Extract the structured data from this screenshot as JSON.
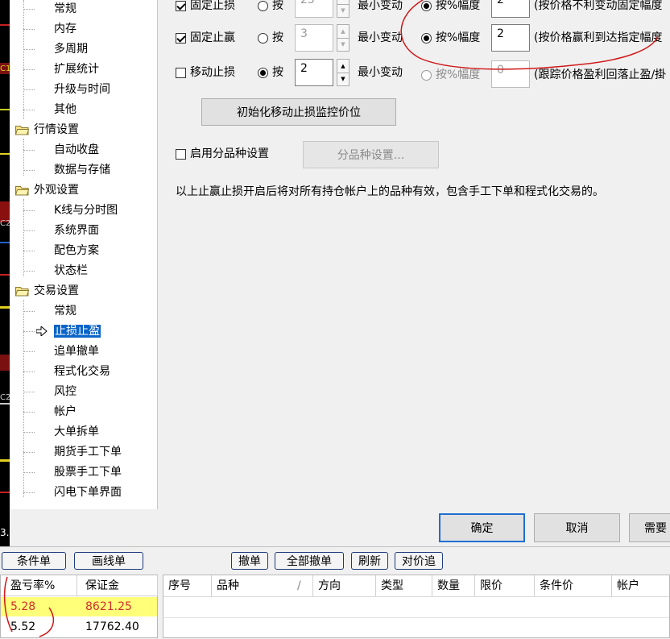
{
  "tree": {
    "items": [
      {
        "id": "general1",
        "label": "常规",
        "type": "child"
      },
      {
        "id": "memory",
        "label": "内存",
        "type": "child"
      },
      {
        "id": "multiperiod",
        "label": "多周期",
        "type": "child"
      },
      {
        "id": "extstats",
        "label": "扩展统计",
        "type": "child"
      },
      {
        "id": "upgrade",
        "label": "升级与时间",
        "type": "child"
      },
      {
        "id": "other",
        "label": "其他",
        "type": "child"
      },
      {
        "id": "quote",
        "label": "行情设置",
        "type": "group"
      },
      {
        "id": "autoclose",
        "label": "自动收盘",
        "type": "child"
      },
      {
        "id": "datastore",
        "label": "数据与存储",
        "type": "child"
      },
      {
        "id": "appearance",
        "label": "外观设置",
        "type": "group"
      },
      {
        "id": "kline",
        "label": "K线与分时图",
        "type": "child"
      },
      {
        "id": "sysui",
        "label": "系统界面",
        "type": "child"
      },
      {
        "id": "colors",
        "label": "配色方案",
        "type": "child"
      },
      {
        "id": "statusbar",
        "label": "状态栏",
        "type": "child"
      },
      {
        "id": "trade",
        "label": "交易设置",
        "type": "group"
      },
      {
        "id": "general2",
        "label": "常规",
        "type": "child"
      },
      {
        "id": "stoploss",
        "label": "止损止盈",
        "type": "child",
        "selected": true
      },
      {
        "id": "chase",
        "label": "追单撤单",
        "type": "child"
      },
      {
        "id": "algo",
        "label": "程式化交易",
        "type": "child"
      },
      {
        "id": "risk",
        "label": "风控",
        "type": "child"
      },
      {
        "id": "account",
        "label": "帐户",
        "type": "child"
      },
      {
        "id": "split",
        "label": "大单拆单",
        "type": "child"
      },
      {
        "id": "futures",
        "label": "期货手工下单",
        "type": "child"
      },
      {
        "id": "stocks",
        "label": "股票手工下单",
        "type": "child"
      },
      {
        "id": "flash",
        "label": "闪电下单界面",
        "type": "child"
      }
    ]
  },
  "stop_settings": {
    "fixed_stop_loss": {
      "label": "固定止损",
      "checked": true,
      "by_label": "按",
      "by_value": "25",
      "min_change": "最小变动",
      "pct_label": "按%幅度",
      "pct_value": "2",
      "desc": "(按价格不利变动固定幅度"
    },
    "fixed_take_profit": {
      "label": "固定止赢",
      "checked": true,
      "by_label": "按",
      "by_value": "3",
      "min_change": "最小变动",
      "pct_label": "按%幅度",
      "pct_value": "2",
      "desc": "(按价格赢利到达指定幅度"
    },
    "trailing_stop": {
      "label": "移动止损",
      "checked": false,
      "by_label": "按",
      "by_value": "2",
      "min_change": "最小变动",
      "pct_label": "按%幅度",
      "pct_value": "0",
      "desc": "(跟踪价格盈利回落止盈/掛"
    }
  },
  "init_trailing_button": "初始化移动止损监控价位",
  "per_product": {
    "checkbox_label": "启用分品种设置",
    "button_label": "分品种设置..."
  },
  "note": "以上止赢止损开启后将对所有持仓帐户上的品种有效，包含手工下单和程式化交易的。",
  "dialog_buttons": {
    "ok": "确定",
    "cancel": "取消",
    "more": "需要"
  },
  "left_fragments": {
    "b3": "3.",
    "c1": "C1",
    "c2": "C2",
    "c3": "C2"
  },
  "toolbar": {
    "condition_order": "条件单",
    "line_order": "画线单",
    "cancel": "撤单",
    "cancel_all": "全部撤单",
    "refresh": "刷新",
    "opposite": "对价追"
  },
  "positions": {
    "headers": [
      "盈亏率%",
      "保证金"
    ],
    "rows": [
      {
        "rate": "5.28",
        "margin": "8621.25"
      },
      {
        "rate": "5.52",
        "margin": "17762.40"
      }
    ]
  },
  "orders": {
    "headers": [
      "序号",
      "品种",
      "/",
      "方向",
      "类型",
      "数量",
      "限价",
      "条件价",
      "帐户"
    ]
  },
  "colors": {
    "selected": "#0a64c8",
    "highlight_row": "#ffff7a",
    "rate_text": "#d03030",
    "annotation": "#d01818"
  }
}
